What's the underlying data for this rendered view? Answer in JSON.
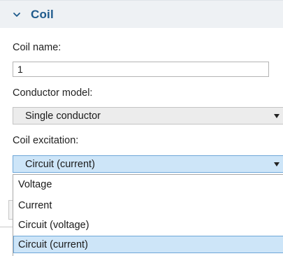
{
  "section": {
    "title": "Coil",
    "toggle_icon": "chevron-down-icon"
  },
  "fields": {
    "coil_name_label": "Coil name:",
    "coil_name_value": "1",
    "conductor_model_label": "Conductor model:",
    "conductor_model_value": "Single conductor",
    "coil_excitation_label": "Coil excitation:",
    "coil_excitation_value": "Circuit (current)"
  },
  "dropdown": {
    "options": [
      "Voltage",
      "Current",
      "Circuit (voltage)",
      "Circuit (current)"
    ],
    "selected_index": 3
  },
  "colors": {
    "section_title": "#1e5a8c",
    "header_bg": "#eef1f4",
    "selection_bg": "#cde5f8",
    "selection_border": "#6ea7d8"
  }
}
